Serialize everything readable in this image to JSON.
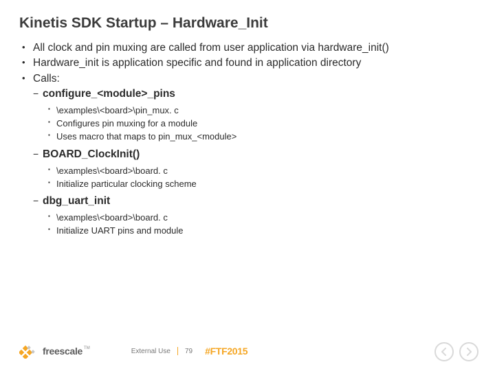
{
  "title": "Kinetis SDK Startup – Hardware_Init",
  "bullets": {
    "b0": "All clock and pin muxing are called from user application via hardware_init()",
    "b1": "Hardware_init is application specific and found in application directory",
    "b2": "Calls:",
    "s1a": "configure_<module>_pins",
    "s1a_1": "\\examples\\<board>\\pin_mux. c",
    "s1a_2": "Configures pin muxing for a module",
    "s1a_3": "Uses macro that maps to pin_mux_<module>",
    "s1b": "BOARD_ClockInit()",
    "s1b_1": "\\examples\\<board>\\board. c",
    "s1b_2": "Initialize particular clocking scheme",
    "s1c": "dbg_uart_init",
    "s1c_1": "\\examples\\<board>\\board. c",
    "s1c_2": "Initialize UART pins and module"
  },
  "footer": {
    "brand": "freescale",
    "tm": "TM",
    "label": "External Use",
    "page": "79",
    "hashtag": "#FTF2015"
  },
  "colors": {
    "accent": "#f5a623",
    "nav": "#d9d9d9"
  }
}
